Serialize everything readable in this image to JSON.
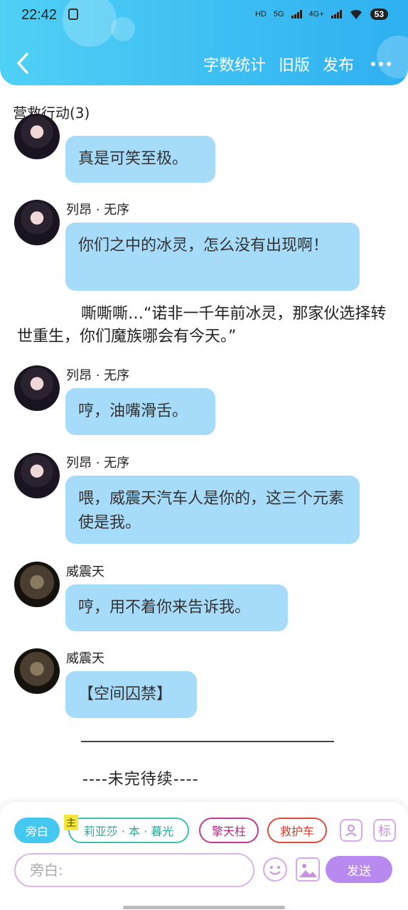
{
  "statusbar": {
    "time": "22:42",
    "network": "5G",
    "network2": "4G+",
    "battery": "53"
  },
  "header": {
    "word_count": "字数统计",
    "old_version": "旧版",
    "publish": "发布"
  },
  "chat": {
    "title": "营救行动(3)"
  },
  "messages": [
    {
      "sender": "",
      "text": "真是可笑至极。",
      "avatar": "girl"
    },
    {
      "sender": "列昂 · 无序",
      "text": "你们之中的冰灵，怎么没有出现啊！",
      "avatar": "girl"
    },
    {
      "sender": "列昂 · 无序",
      "text": "哼，油嘴滑舌。",
      "avatar": "girl"
    },
    {
      "sender": "列昂 · 无序",
      "text": "喂，威震天汽车人是你的，这三个元素使是我。",
      "avatar": "girl"
    },
    {
      "sender": "威震天",
      "text": "哼，用不着你来告诉我。",
      "avatar": "robot"
    },
    {
      "sender": "威震天",
      "text": "【空间囚禁】",
      "avatar": "robot"
    }
  ],
  "narration": "嘶嘶嘶…“诺非一千年前冰灵，那家伙选择转世重生，你们魔族哪会有今天。”",
  "ending": "----未完待续----",
  "roles": {
    "narrator": "旁白",
    "main_tag": "主",
    "char1": "莉亚莎 · 本 · 暮光",
    "char2": "擎天柱",
    "char3": "救护车",
    "tag_icon": "标"
  },
  "input": {
    "placeholder": "旁白:",
    "send": "发送"
  }
}
